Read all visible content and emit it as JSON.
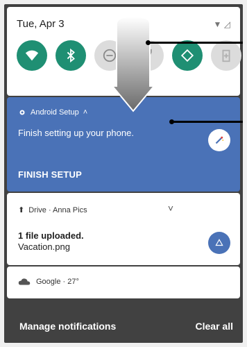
{
  "quick_settings": {
    "date": "Tue, Apr 3",
    "tiles": [
      {
        "name": "wifi-icon",
        "state": "on"
      },
      {
        "name": "bluetooth-icon",
        "state": "on"
      },
      {
        "name": "do-not-disturb-icon",
        "state": "off"
      },
      {
        "name": "flashlight-icon",
        "state": "off"
      },
      {
        "name": "auto-rotate-icon",
        "state": "on"
      },
      {
        "name": "battery-saver-icon",
        "state": "off"
      }
    ]
  },
  "notifications": {
    "setup": {
      "app": "Android Setup",
      "message": "Finish setting up your phone.",
      "action": "FINISH SETUP"
    },
    "drive": {
      "header": "Drive · Anna Pics",
      "title": "1 file uploaded.",
      "file": "Vacation.png"
    },
    "weather": {
      "text": "Google · 27°"
    }
  },
  "footer": {
    "manage": "Manage notifications",
    "clear": "Clear all"
  },
  "colors": {
    "tile_on": "#1f8f73",
    "setup_bg": "#4a72b7",
    "frame_bg": "#414141"
  }
}
